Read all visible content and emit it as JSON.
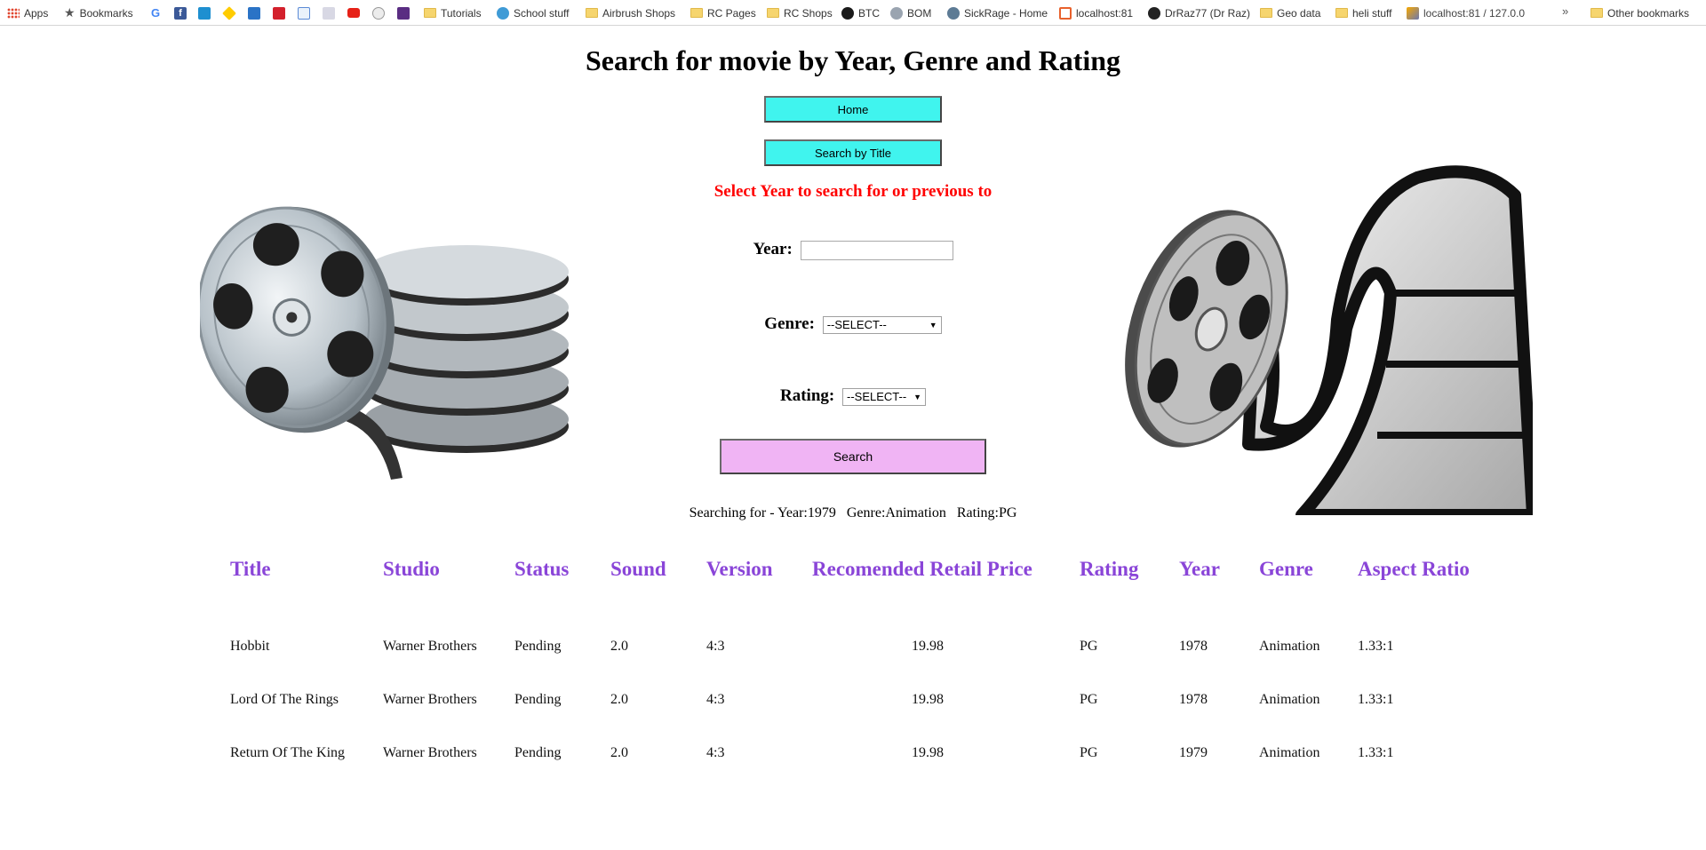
{
  "bookmarks": [
    {
      "label": "Apps",
      "icon": "apps-grid-icon"
    },
    {
      "label": "Bookmarks",
      "icon": "star-icon"
    },
    {
      "label": "",
      "icon": "google-icon"
    },
    {
      "label": "",
      "icon": "facebook-icon"
    },
    {
      "label": "",
      "icon": "site-icon"
    },
    {
      "label": "",
      "icon": "commbank-icon"
    },
    {
      "label": "",
      "icon": "site-icon"
    },
    {
      "label": "",
      "icon": "site-icon"
    },
    {
      "label": "",
      "icon": "site-icon"
    },
    {
      "label": "",
      "icon": "site-icon"
    },
    {
      "label": "",
      "icon": "youtube-icon"
    },
    {
      "label": "",
      "icon": "reddit-icon"
    },
    {
      "label": "",
      "icon": "site-icon"
    },
    {
      "label": "Tutorials",
      "icon": "folder-icon"
    },
    {
      "label": "School stuff",
      "icon": "site-icon"
    },
    {
      "label": "Airbrush Shops",
      "icon": "folder-icon"
    },
    {
      "label": "RC Pages",
      "icon": "folder-icon"
    },
    {
      "label": "RC Shops",
      "icon": "folder-icon"
    },
    {
      "label": "BTC",
      "icon": "site-icon"
    },
    {
      "label": "BOM",
      "icon": "site-icon"
    },
    {
      "label": "SickRage - Home",
      "icon": "site-icon"
    },
    {
      "label": "localhost:81",
      "icon": "site-icon"
    },
    {
      "label": "DrRaz77 (Dr Raz)",
      "icon": "github-icon"
    },
    {
      "label": "Geo data",
      "icon": "folder-icon"
    },
    {
      "label": "heli stuff",
      "icon": "folder-icon"
    },
    {
      "label": "localhost:81 / 127.0.0",
      "icon": "site-icon"
    },
    {
      "label": "Other bookmarks",
      "icon": "folder-icon"
    }
  ],
  "bookmarks_overflow": "»",
  "page": {
    "title": "Search for movie by Year, Genre and Rating",
    "home_button": "Home",
    "search_title_button": "Search by Title",
    "instruction": "Select Year to search for or previous to",
    "year_label": "Year:",
    "year_value": "",
    "genre_label": "Genre:",
    "genre_selected": "--SELECT--",
    "rating_label": "Rating:",
    "rating_selected": "--SELECT--",
    "search_button": "Search",
    "summary": {
      "prefix": "Searching for - Year:1979",
      "genre": "Genre:Animation",
      "rating": "Rating:PG"
    }
  },
  "table": {
    "headers": [
      "Title",
      "Studio",
      "Status",
      "Sound",
      "Version",
      "Recomended Retail Price",
      "Rating",
      "Year",
      "Genre",
      "Aspect Ratio"
    ],
    "rows": [
      [
        "Hobbit",
        "Warner Brothers",
        "Pending",
        "2.0",
        "4:3",
        "19.98",
        "PG",
        "1978",
        "Animation",
        "1.33:1"
      ],
      [
        "Lord Of The Rings",
        "Warner Brothers",
        "Pending",
        "2.0",
        "4:3",
        "19.98",
        "PG",
        "1978",
        "Animation",
        "1.33:1"
      ],
      [
        "Return Of The King",
        "Warner Brothers",
        "Pending",
        "2.0",
        "4:3",
        "19.98",
        "PG",
        "1979",
        "Animation",
        "1.33:1"
      ]
    ]
  }
}
